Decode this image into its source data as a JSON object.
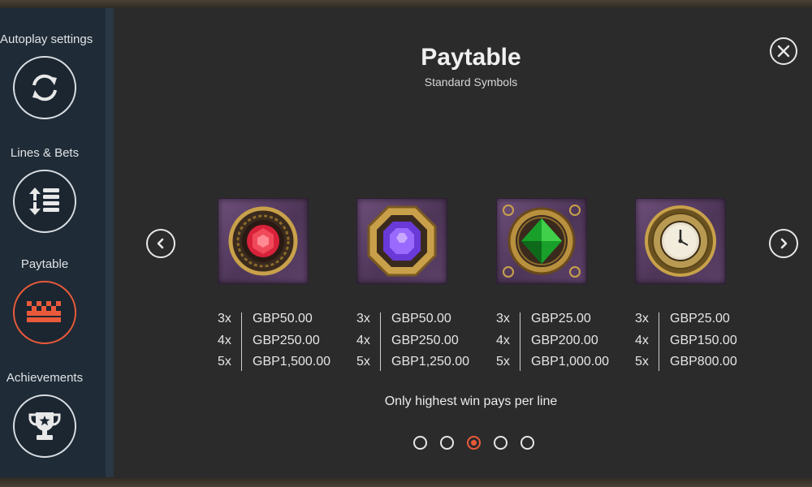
{
  "sidebar": {
    "items": [
      {
        "label": "Autoplay settings",
        "icon": "refresh-icon",
        "active": false
      },
      {
        "label": "Lines & Bets",
        "icon": "lines-bets-icon",
        "active": false
      },
      {
        "label": "Paytable",
        "icon": "paytable-grid-icon",
        "active": true
      },
      {
        "label": "Achievements",
        "icon": "trophy-icon",
        "active": false
      }
    ]
  },
  "header": {
    "title": "Paytable",
    "subtitle": "Standard Symbols"
  },
  "symbols": [
    {
      "icon": "red-gem-symbol",
      "pays": [
        {
          "mult": "3x",
          "amount": "GBP50.00"
        },
        {
          "mult": "4x",
          "amount": "GBP250.00"
        },
        {
          "mult": "5x",
          "amount": "GBP1,500.00"
        }
      ]
    },
    {
      "icon": "purple-gem-symbol",
      "pays": [
        {
          "mult": "3x",
          "amount": "GBP50.00"
        },
        {
          "mult": "4x",
          "amount": "GBP250.00"
        },
        {
          "mult": "5x",
          "amount": "GBP1,250.00"
        }
      ]
    },
    {
      "icon": "green-gem-symbol",
      "pays": [
        {
          "mult": "3x",
          "amount": "GBP25.00"
        },
        {
          "mult": "4x",
          "amount": "GBP200.00"
        },
        {
          "mult": "5x",
          "amount": "GBP1,000.00"
        }
      ]
    },
    {
      "icon": "clock-symbol",
      "pays": [
        {
          "mult": "3x",
          "amount": "GBP25.00"
        },
        {
          "mult": "4x",
          "amount": "GBP150.00"
        },
        {
          "mult": "5x",
          "amount": "GBP800.00"
        }
      ]
    }
  ],
  "note": "Only highest win pays per line",
  "pagination": {
    "total": 5,
    "current": 3
  },
  "colors": {
    "accent": "#ea5a3a",
    "sidebar": "#1f2b36",
    "panel": "#2b2b2b"
  }
}
